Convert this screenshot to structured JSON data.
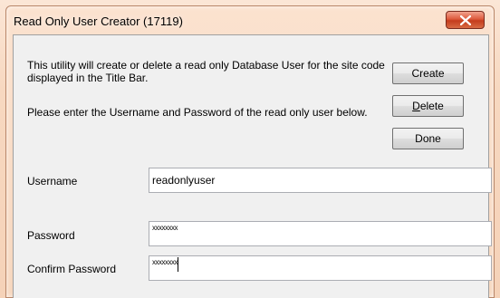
{
  "window": {
    "title": "Read Only User Creator (17119)",
    "close_icon": "close-x-icon"
  },
  "description": {
    "line1": "This utility will create or delete a read only Database User for the site code displayed in the Title Bar.",
    "line2": "Please enter the Username and Password of the read only user below."
  },
  "buttons": {
    "create_label": "Create",
    "delete_label": "Delete",
    "delete_mnemonic": "D",
    "delete_rest": "elete",
    "done_label": "Done"
  },
  "form": {
    "username_label": "Username",
    "username_value": "readonlyuser",
    "password_label": "Password",
    "password_mask": "xxxxxxxx",
    "confirm_label": "Confirm Password",
    "confirm_mask": "xxxxxxxx"
  },
  "colors": {
    "close_button": "#d45437",
    "title_glow": "#f6d6bd",
    "client_bg": "#f0f0f0"
  }
}
